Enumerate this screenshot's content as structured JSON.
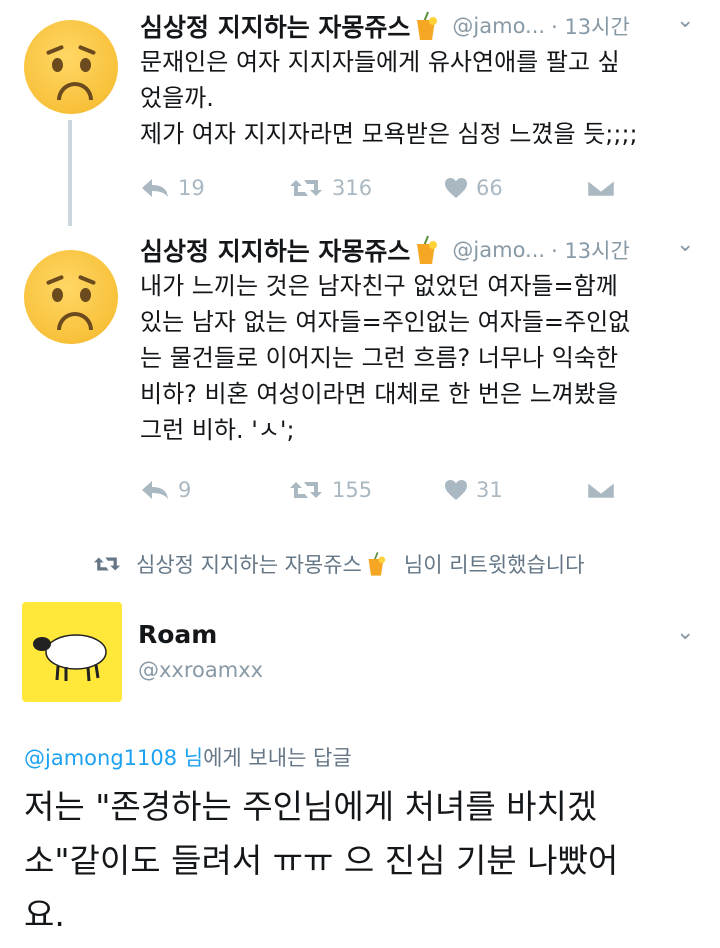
{
  "thread": [
    {
      "author_name": "심상정 지지하는 자몽쥬스",
      "handle": "@jamo...",
      "time": "· 13시간",
      "text_lines": [
        "문재인은 여자 지지자들에게 유사연애를 팔고 싶",
        "었을까.",
        "제가 여자 지지자라면 모욕받은 심정 느꼈을 듯;;;;"
      ],
      "replies": "19",
      "retweets": "316",
      "likes": "66"
    },
    {
      "author_name": "심상정 지지하는 자몽쥬스",
      "handle": "@jamo...",
      "time": "· 13시간",
      "text_lines": [
        "내가 느끼는 것은 남자친구 없었던 여자들=함께",
        "있는 남자 없는 여자들=주인없는 여자들=주인없",
        "는 물건들로 이어지는 그런 흐름? 너무나 익숙한",
        "비하? 비혼 여성이라면 대체로 한 번은 느껴봤을",
        "그런 비하. 'ㅅ';"
      ],
      "replies": "9",
      "retweets": "155",
      "likes": "31"
    }
  ],
  "retweet_banner": {
    "prefix": "심상정 지지하는 자몽쥬스",
    "suffix": "님이 리트윗했습니다"
  },
  "reply": {
    "author_name": "Roam",
    "handle": "@xxroamxx",
    "reply_to_mention": "@jamong1108",
    "reply_to_rest_1": "님",
    "reply_to_rest_2": "에게 보내는 답글",
    "text_lines": [
      "저는 \"존경하는 주인님에게 처녀를 바치겠",
      "소\"같이도 들려서 ㅠㅠ 으 진심 기분 나빴어",
      "요."
    ]
  },
  "colors": {
    "action_gray": "#aab8c2",
    "link_blue": "#1da1f2",
    "roam_avatar_bg": "#ffe83a",
    "thread_line": "#ccd6dd"
  },
  "icons": [
    "reply-icon",
    "retweet-icon",
    "like-icon",
    "dm-icon",
    "chevron-down-icon",
    "juice-emoji-icon",
    "worried-face-avatar",
    "sheep-avatar"
  ]
}
